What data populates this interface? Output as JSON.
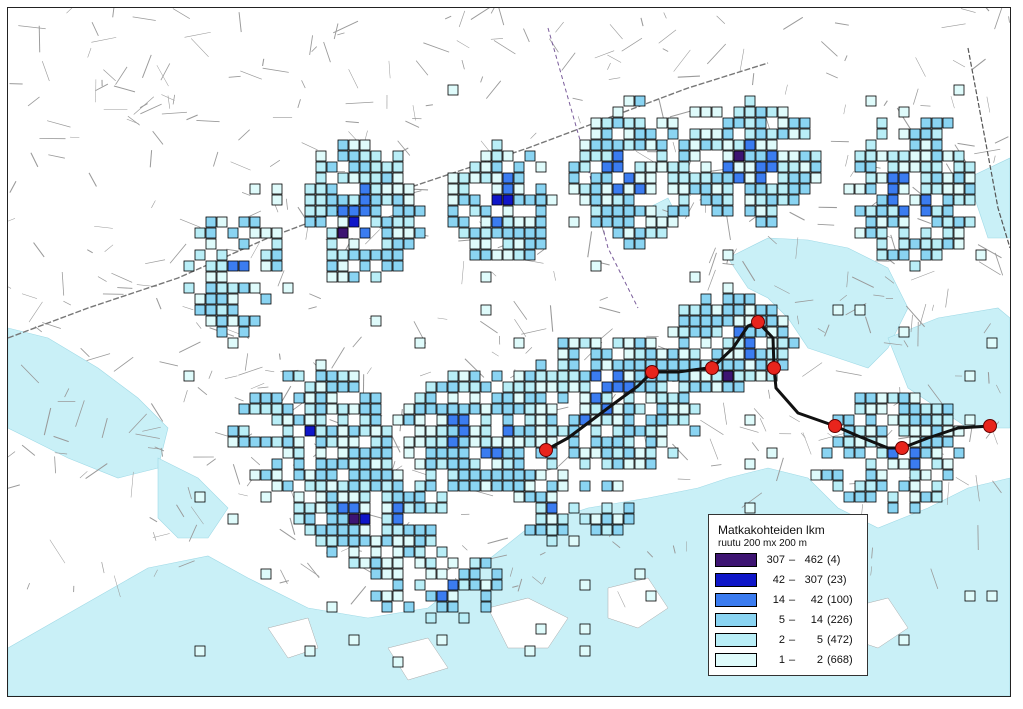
{
  "legend": {
    "title": "Matkakohteiden lkm",
    "subtitle": "ruutu 200 mx 200 m",
    "classes": [
      {
        "min": "307",
        "max": "462",
        "count": "(4)",
        "color": "#3d1472"
      },
      {
        "min": "42",
        "max": "307",
        "count": "(23)",
        "color": "#0f16c8"
      },
      {
        "min": "14",
        "max": "42",
        "count": "(100)",
        "color": "#3b7cf0"
      },
      {
        "min": "5",
        "max": "14",
        "count": "(226)",
        "color": "#8ad4f2"
      },
      {
        "min": "2",
        "max": "5",
        "count": "(472)",
        "color": "#b9eef7"
      },
      {
        "min": "1",
        "max": "2",
        "count": "(668)",
        "color": "#dffbfb"
      }
    ]
  },
  "colors": {
    "water": "#c9f0f7",
    "land": "#ffffff",
    "roads": "#9a9a9a",
    "route": "#111111",
    "stations": "#e8241c"
  },
  "map": {
    "route": {
      "name": "route-line",
      "station_count": 8
    }
  }
}
